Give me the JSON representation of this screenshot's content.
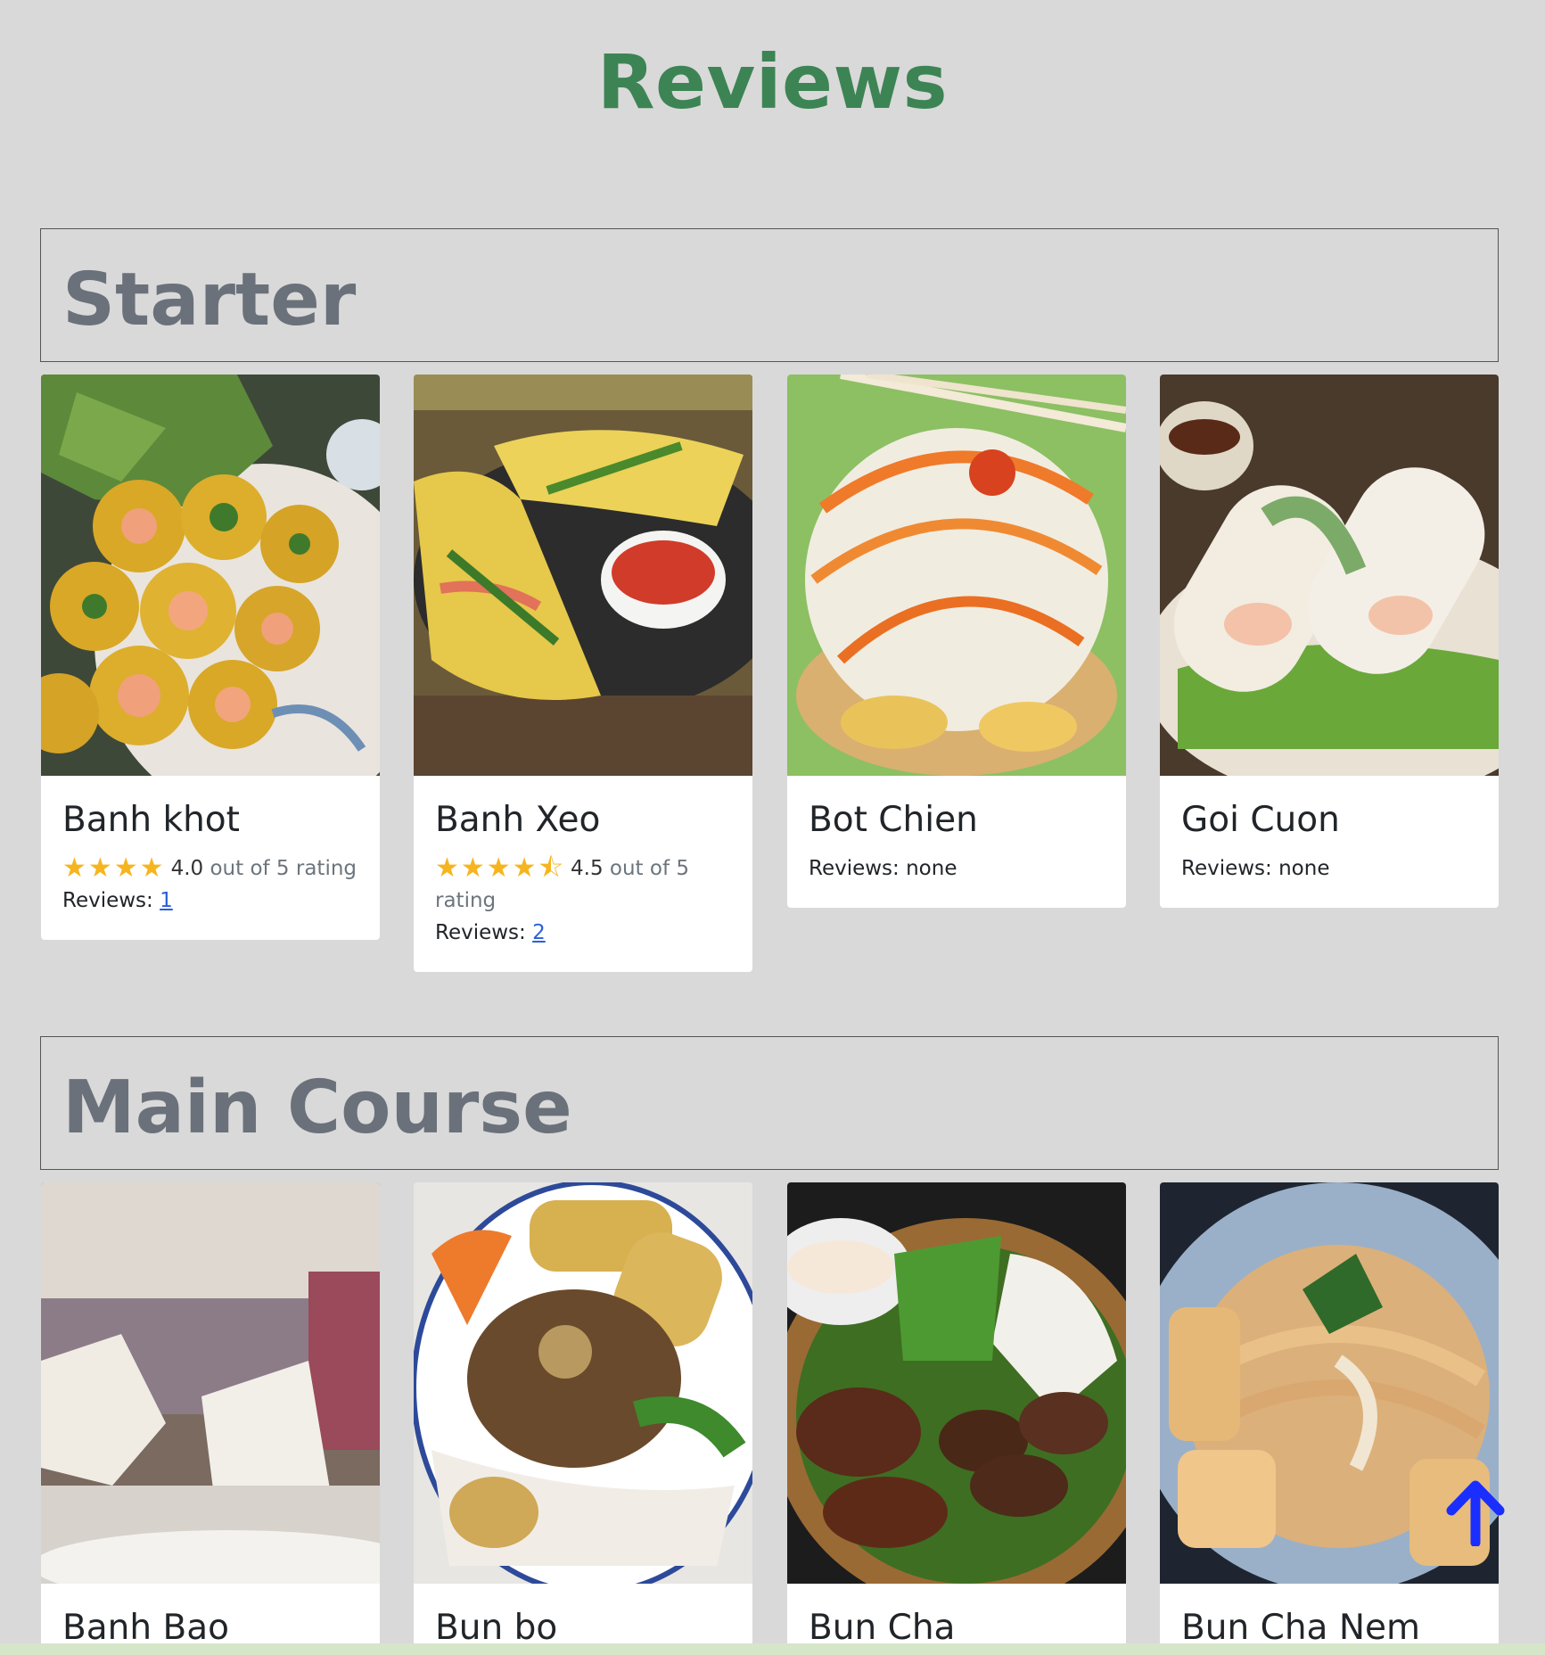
{
  "page_title": "Reviews",
  "sections": [
    {
      "title": "Starter",
      "cards": [
        {
          "name": "Banh khot",
          "stars": "★★★★",
          "rating_value": "4.0",
          "rating_suffix": "out of 5 rating",
          "reviews_label": "Reviews:",
          "reviews_value": "1"
        },
        {
          "name": "Banh Xeo",
          "stars": "★★★★⯪",
          "rating_value": "4.5",
          "rating_suffix": "out of 5 rating",
          "reviews_label": "Reviews:",
          "reviews_value": "2"
        },
        {
          "name": "Bot Chien",
          "reviews_label": "Reviews:",
          "reviews_value": "none"
        },
        {
          "name": "Goi Cuon",
          "reviews_label": "Reviews:",
          "reviews_value": "none"
        }
      ]
    },
    {
      "title": "Main Course",
      "cards": [
        {
          "name": "Banh Bao"
        },
        {
          "name": "Bun bo"
        },
        {
          "name": "Bun Cha"
        },
        {
          "name": "Bun Cha Nem"
        }
      ]
    }
  ],
  "colors": {
    "background": "#d9d9d9",
    "title_green": "#3d8454",
    "section_gray": "#6b717a",
    "star_gold": "#f6b51e",
    "link_blue": "#2a5fd6",
    "scroll_arrow_blue": "#1a2eff"
  },
  "icons": {
    "rating": "star-icon",
    "scroll": "arrow-up-icon"
  }
}
